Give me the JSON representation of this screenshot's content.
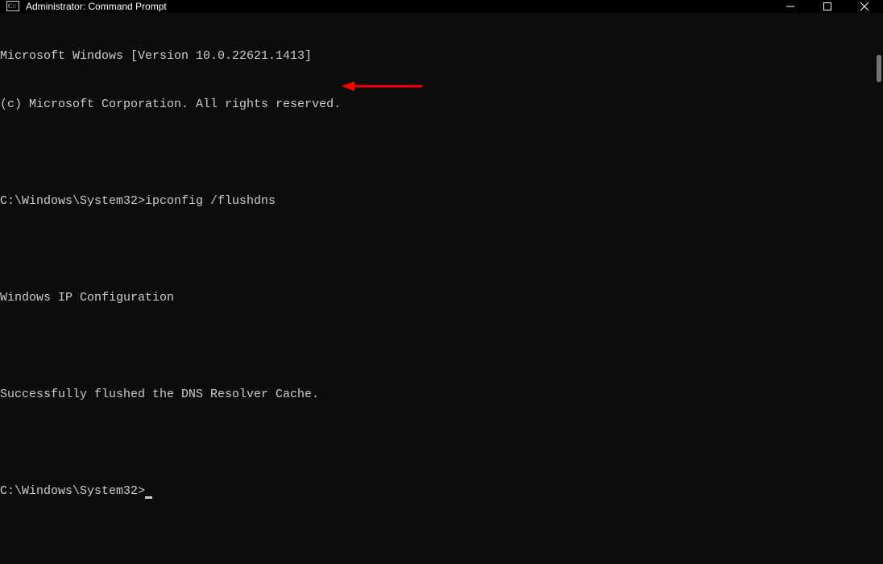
{
  "window": {
    "title": "Administrator: Command Prompt"
  },
  "terminal": {
    "lines": {
      "l0": "Microsoft Windows [Version 10.0.22621.1413]",
      "l1": "(c) Microsoft Corporation. All rights reserved.",
      "l2": "",
      "l3": "C:\\Windows\\System32>ipconfig /flushdns",
      "l4": "",
      "l5": "Windows IP Configuration",
      "l6": "",
      "l7": "Successfully flushed the DNS Resolver Cache.",
      "l8": "",
      "l9": "C:\\Windows\\System32>"
    }
  },
  "annotation": {
    "arrow_color": "#ff0000"
  }
}
